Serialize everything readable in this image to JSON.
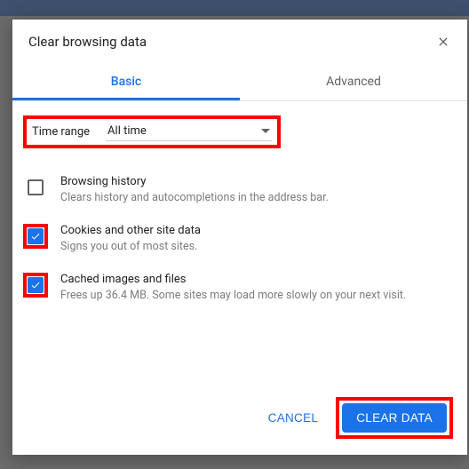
{
  "dialog": {
    "title": "Clear browsing data",
    "tabs": {
      "basic": "Basic",
      "advanced": "Advanced"
    },
    "time": {
      "label": "Time range",
      "value": "All time"
    },
    "options": [
      {
        "title": "Browsing history",
        "desc": "Clears history and autocompletions in the address bar.",
        "checked": false,
        "highlight": false
      },
      {
        "title": "Cookies and other site data",
        "desc": "Signs you out of most sites.",
        "checked": true,
        "highlight": true
      },
      {
        "title": "Cached images and files",
        "desc": "Frees up 36.4 MB. Some sites may load more slowly on your next visit.",
        "checked": true,
        "highlight": true
      }
    ],
    "buttons": {
      "cancel": "CANCEL",
      "clear": "CLEAR DATA"
    }
  }
}
